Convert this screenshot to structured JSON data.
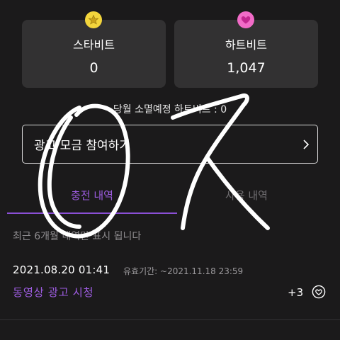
{
  "balances": {
    "star": {
      "label": "스타비트",
      "value": "0",
      "icon": "star-coin-icon",
      "color": "#f3d53c"
    },
    "heart": {
      "label": "하트비트",
      "value": "1,047",
      "icon": "heart-coin-icon",
      "color": "#f16bc7"
    }
  },
  "expiry_note": "당월 소멸예정 하트비트 : 0",
  "ad_button": {
    "label": "광고 모금 참여하기",
    "icon": "chevron-right-icon"
  },
  "tabs": [
    {
      "label": "충전 내역",
      "active": true,
      "color": "#9d5ce0"
    },
    {
      "label": "사용 내역",
      "active": false,
      "color": "#6f6d70"
    }
  ],
  "notice": "최근 6개월 내역만 표시 됩니다",
  "history": [
    {
      "datetime": "2021.08.20 01:41",
      "expiry_label": "유효기간: ~2021.11.18 23:59",
      "title": "동영상 광고 시청",
      "amount": "+3",
      "icon": "heart-outline-icon"
    }
  ],
  "accent_color": "#9d5ce0"
}
